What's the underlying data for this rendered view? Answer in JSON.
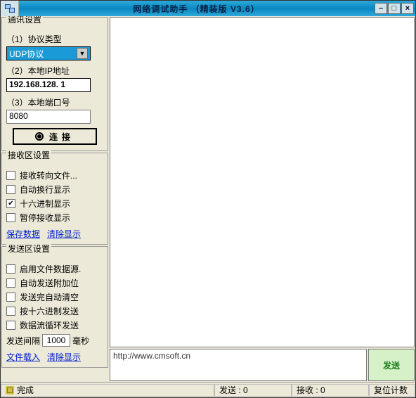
{
  "window": {
    "title": "网络调试助手 （精装版 V3.6）"
  },
  "comm": {
    "groupTitle": "通讯设置",
    "protocolLabel": "（1）协议类型",
    "protocolValue": "UDP协议",
    "ipLabel": "（2）本地IP地址",
    "ipValue": "192.168.128. 1",
    "portLabel": "（3）本地端口号",
    "portValue": "8080",
    "connectLabel": "连接"
  },
  "recv": {
    "groupTitle": "接收区设置",
    "opts": {
      "toFile": "接收转向文件...",
      "autoWrap": "自动换行显示",
      "hex": "十六进制显示",
      "pause": "暂停接收显示"
    },
    "saveLink": "保存数据",
    "clearLink": "清除显示"
  },
  "send": {
    "groupTitle": "发送区设置",
    "opts": {
      "fileSrc": "启用文件数据源.",
      "autoAppend": "自动发送附加位",
      "autoClear": "发送完自动清空",
      "hexSend": "按十六进制发送",
      "loopSend": "数据流循环发送"
    },
    "intervalLabelPrefix": "发送间隔",
    "intervalValue": "1000",
    "intervalLabelSuffix": "毫秒",
    "loadLink": "文件载入",
    "clearLink": "清除显示"
  },
  "main": {
    "sendText": "http://www.cmsoft.cn",
    "sendButton": "发送"
  },
  "status": {
    "ready": "完成",
    "sendCount": "发送 : 0",
    "recvCount": "接收 : 0",
    "reset": "复位计数"
  }
}
